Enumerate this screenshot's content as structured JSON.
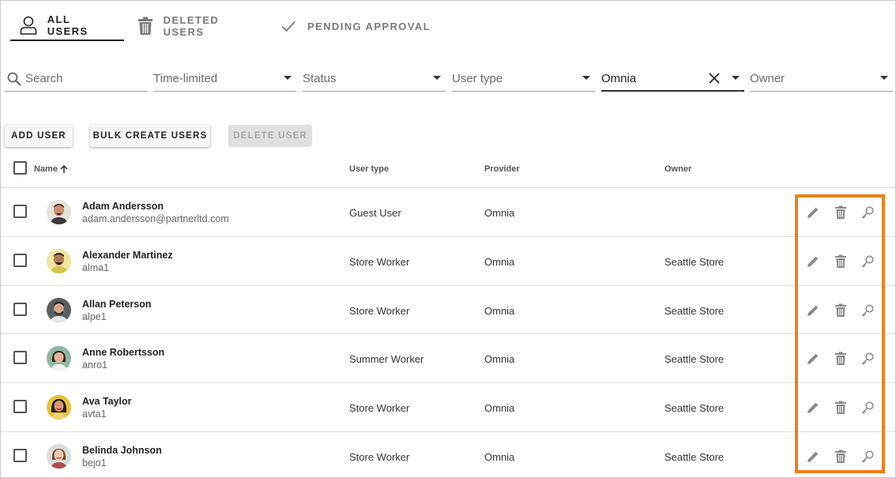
{
  "tabs": [
    {
      "label": "ALL USERS",
      "icon": "person-icon",
      "active": true
    },
    {
      "label": "DELETED USERS",
      "icon": "trash-icon",
      "active": false
    },
    {
      "label": "PENDING APPROVAL",
      "icon": "check-icon",
      "active": false
    }
  ],
  "filters": {
    "search_placeholder": "Search",
    "time_limited": "Time-limited",
    "status": "Status",
    "user_type": "User type",
    "provider_value": "Omnia",
    "owner": "Owner"
  },
  "buttons": {
    "add_user": "ADD USER",
    "bulk_create": "BULK CREATE USERS",
    "delete_user": "DELETE USER"
  },
  "table": {
    "headers": {
      "name": "Name",
      "user_type": "User type",
      "provider": "Provider",
      "owner": "Owner"
    },
    "rows": [
      {
        "name": "Adam Andersson",
        "sub": "adam.andersson@partnerltd.com",
        "user_type": "Guest User",
        "provider": "Omnia",
        "owner": ""
      },
      {
        "name": "Alexander Martinez",
        "sub": "alma1",
        "user_type": "Store Worker",
        "provider": "Omnia",
        "owner": "Seattle Store"
      },
      {
        "name": "Allan Peterson",
        "sub": "alpe1",
        "user_type": "Store Worker",
        "provider": "Omnia",
        "owner": "Seattle Store"
      },
      {
        "name": "Anne Robertsson",
        "sub": "anro1",
        "user_type": "Summer Worker",
        "provider": "Omnia",
        "owner": "Seattle Store"
      },
      {
        "name": "Ava Taylor",
        "sub": "avta1",
        "user_type": "Store Worker",
        "provider": "Omnia",
        "owner": "Seattle Store"
      },
      {
        "name": "Belinda Johnson",
        "sub": "bejo1",
        "user_type": "Store Worker",
        "provider": "Omnia",
        "owner": "Seattle Store"
      }
    ]
  },
  "colors": {
    "highlight": "#f07f18",
    "icon_gray": "#8a8a8a"
  }
}
